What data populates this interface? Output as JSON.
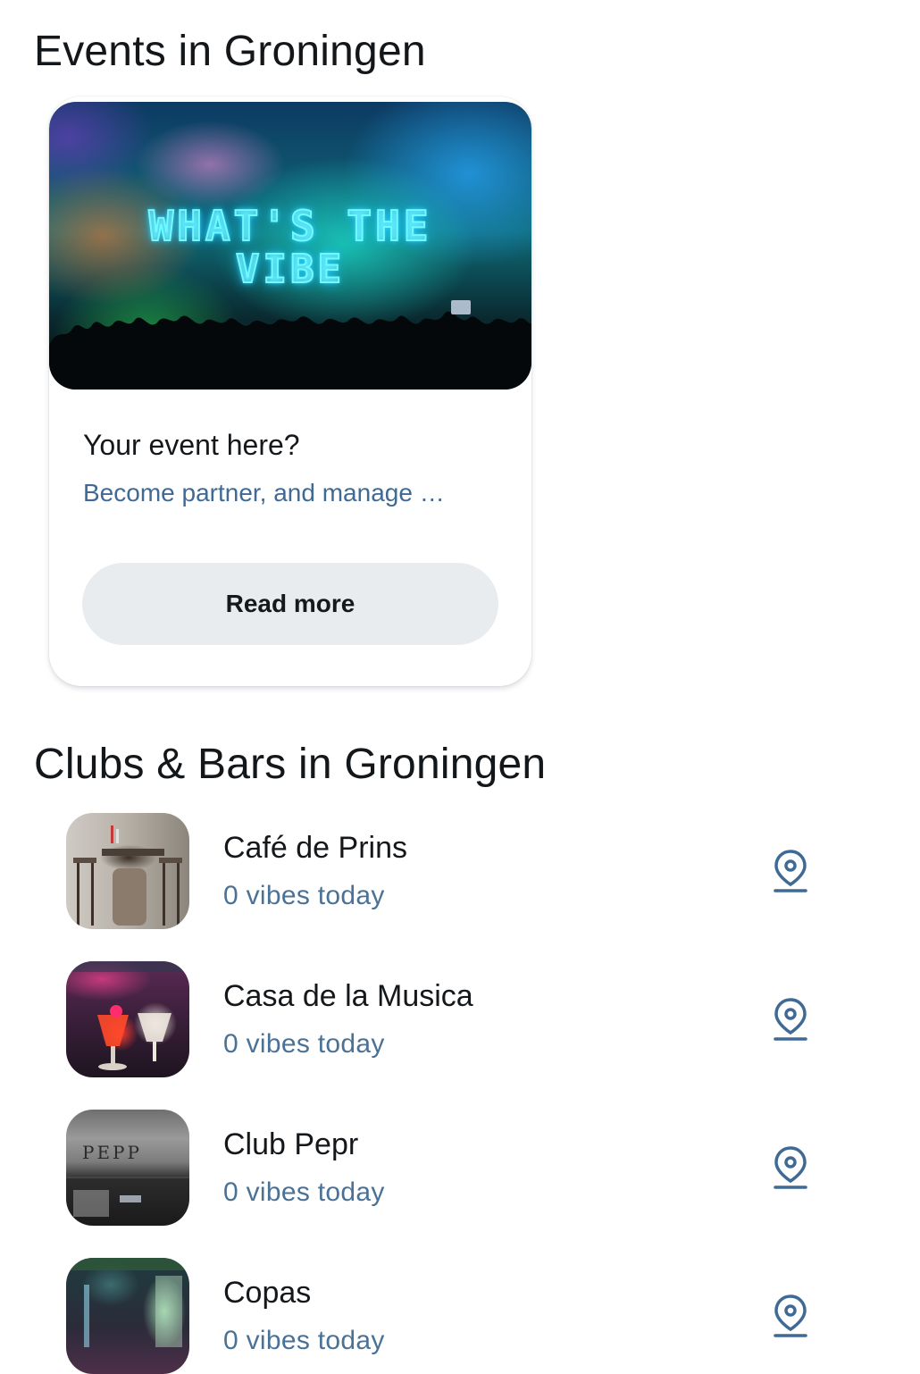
{
  "events": {
    "title": "Events in Groningen",
    "card": {
      "image_text_line1": "WHAT'S THE",
      "image_text_line2": "VIBE",
      "title": "Your event here?",
      "subtitle": "Become partner, and manage …",
      "button_label": "Read more"
    }
  },
  "clubs": {
    "title": "Clubs & Bars in Groningen",
    "thumb_3_sign": "PEPP",
    "items": [
      {
        "name": "Café de Prins",
        "vibes": "0 vibes today",
        "icon": "location-pin-icon"
      },
      {
        "name": "Casa de la Musica",
        "vibes": "0 vibes today",
        "icon": "location-pin-icon"
      },
      {
        "name": "Club Pepr",
        "vibes": "0 vibes today",
        "icon": "location-pin-icon"
      },
      {
        "name": "Copas",
        "vibes": "0 vibes today",
        "icon": "location-pin-icon"
      }
    ]
  },
  "colors": {
    "accent_text": "#3f6a96",
    "pin_icon": "#3f6a96",
    "button_bg": "#e9ecef"
  }
}
